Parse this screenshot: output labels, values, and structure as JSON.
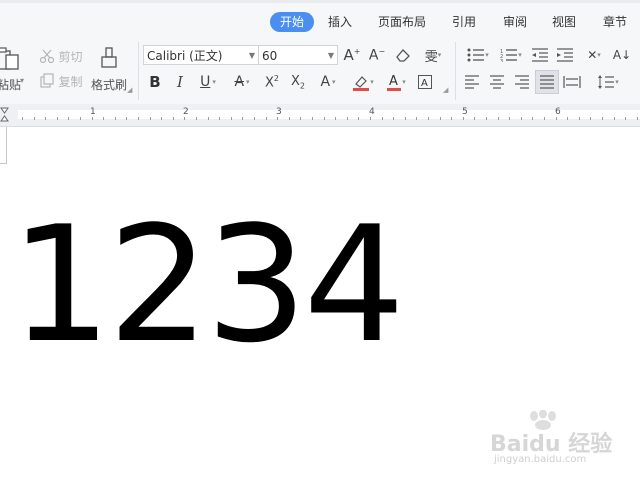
{
  "tabs": [
    {
      "label": "开始",
      "active": true
    },
    {
      "label": "插入"
    },
    {
      "label": "页面布局"
    },
    {
      "label": "引用"
    },
    {
      "label": "审阅"
    },
    {
      "label": "视图"
    },
    {
      "label": "章节"
    }
  ],
  "clipboard": {
    "paste_label": "粘贴",
    "cut_label": "剪切",
    "copy_label": "复制",
    "format_painter_label": "格式刷"
  },
  "font": {
    "family": "Calibri (正文)",
    "size": "60"
  },
  "ruler": {
    "numbers": [
      "1",
      "2",
      "3",
      "4",
      "5",
      "6"
    ]
  },
  "document": {
    "text": "1234"
  },
  "watermark": {
    "brand": "Baidu 经验",
    "url": "jingyan.baidu.com"
  },
  "colors": {
    "accent": "#4a8ef0",
    "ribbon_bg": "#f6f7f9",
    "highlight_red": "#e24b4b"
  },
  "icons": {
    "paste": "clipboard-icon",
    "cut": "scissors-icon",
    "copy": "copy-icon",
    "format_painter": "brush-icon",
    "bold": "bold-icon",
    "italic": "italic-icon",
    "underline": "underline-icon"
  }
}
